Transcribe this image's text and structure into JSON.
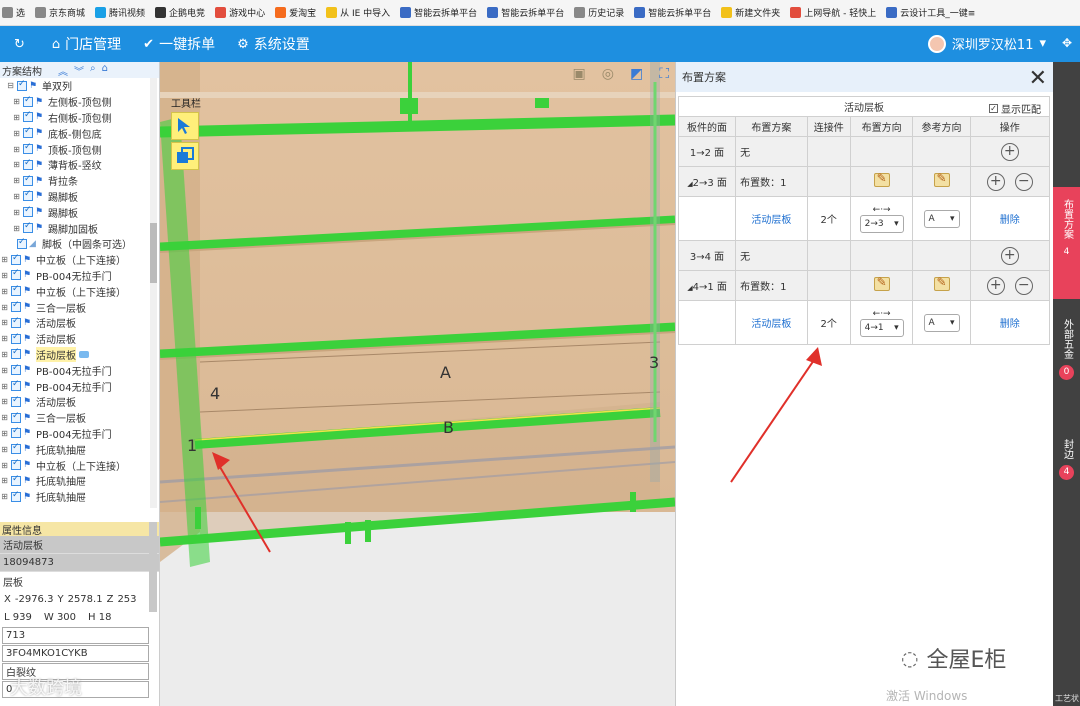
{
  "bookmarks": [
    {
      "label": "选",
      "color": "#888"
    },
    {
      "label": "京东商城",
      "color": "#888"
    },
    {
      "label": "腾讯视频",
      "color": "#19a0e6"
    },
    {
      "label": "企鹅电竞",
      "color": "#333"
    },
    {
      "label": "游戏中心",
      "color": "#e24d3d"
    },
    {
      "label": "爱淘宝",
      "color": "#f56b1d"
    },
    {
      "label": "从 IE 中导入",
      "color": "#f2c11a"
    },
    {
      "label": "智能云拆单平台",
      "color": "#3a6bc4"
    },
    {
      "label": "智能云拆单平台",
      "color": "#3a6bc4"
    },
    {
      "label": "历史记录",
      "color": "#888"
    },
    {
      "label": "智能云拆单平台",
      "color": "#3a6bc4"
    },
    {
      "label": "新建文件夹",
      "color": "#f2c11a"
    },
    {
      "label": "上网导航 - 轻快上",
      "color": "#e24d3d"
    },
    {
      "label": "云设计工具_一键≡",
      "color": "#3a6bc4"
    }
  ],
  "nav": {
    "items": [
      {
        "icon": "refresh-icon",
        "glyph": "↻",
        "label": ""
      },
      {
        "icon": "home-icon",
        "glyph": "⌂",
        "label": "门店管理"
      },
      {
        "icon": "shield-check-icon",
        "glyph": "✔",
        "label": "一键拆单"
      },
      {
        "icon": "gear-icon",
        "glyph": "⚙",
        "label": "系统设置"
      }
    ],
    "user": "深圳罗汉松11",
    "user_caret": "▾",
    "expand_glyph": "✥"
  },
  "tree": {
    "header": "方案结构",
    "nodes": [
      {
        "label": "单双列",
        "exp": "⊟",
        "flag": true,
        "indent": 1
      },
      {
        "label": "左侧板-顶包侧",
        "exp": "⊞",
        "flag": true,
        "indent": 2
      },
      {
        "label": "右侧板-顶包侧",
        "exp": "⊞",
        "flag": true,
        "indent": 2
      },
      {
        "label": "底板-侧包底",
        "exp": "⊞",
        "flag": true,
        "indent": 2
      },
      {
        "label": "顶板-顶包侧",
        "exp": "⊞",
        "flag": true,
        "indent": 2
      },
      {
        "label": "薄背板-竖纹",
        "exp": "⊞",
        "flag": true,
        "indent": 2
      },
      {
        "label": "背拉条",
        "exp": "⊞",
        "flag": true,
        "indent": 2
      },
      {
        "label": "踢脚板",
        "exp": "⊞",
        "flag": true,
        "indent": 2
      },
      {
        "label": "踢脚板",
        "exp": "⊞",
        "flag": true,
        "indent": 2
      },
      {
        "label": "踢脚加固板",
        "exp": "⊞",
        "flag": true,
        "indent": 2
      },
      {
        "label": "脚板（中圆条可选）",
        "exp": "",
        "flag": false,
        "indent": 1
      },
      {
        "label": "中立板（上下连接）",
        "exp": "⊞",
        "flag": true,
        "indent": 0
      },
      {
        "label": "PB-004无拉手门",
        "exp": "⊞",
        "flag": true,
        "indent": 0
      },
      {
        "label": "中立板（上下连接）",
        "exp": "⊞",
        "flag": true,
        "indent": 0
      },
      {
        "label": "三合一层板",
        "exp": "⊞",
        "flag": true,
        "indent": 0
      },
      {
        "label": "活动层板",
        "exp": "⊞",
        "flag": true,
        "indent": 0
      },
      {
        "label": "活动层板",
        "exp": "⊞",
        "flag": true,
        "indent": 0
      },
      {
        "label": "活动层板",
        "exp": "⊞",
        "flag": true,
        "indent": 0,
        "selected": true
      },
      {
        "label": "PB-004无拉手门",
        "exp": "⊞",
        "flag": true,
        "indent": 0
      },
      {
        "label": "PB-004无拉手门",
        "exp": "⊞",
        "flag": true,
        "indent": 0
      },
      {
        "label": "活动层板",
        "exp": "⊞",
        "flag": true,
        "indent": 0
      },
      {
        "label": "三合一层板",
        "exp": "⊞",
        "flag": true,
        "indent": 0
      },
      {
        "label": "PB-004无拉手门",
        "exp": "⊞",
        "flag": true,
        "indent": 0
      },
      {
        "label": "托底轨抽屉",
        "exp": "⊞",
        "flag": true,
        "indent": 0
      },
      {
        "label": "中立板（上下连接）",
        "exp": "⊞",
        "flag": true,
        "indent": 0
      },
      {
        "label": "托底轨抽屉",
        "exp": "⊞",
        "flag": true,
        "indent": 0
      },
      {
        "label": "托底轨抽屉",
        "exp": "⊞",
        "flag": true,
        "indent": 0
      }
    ]
  },
  "props": {
    "title": "属性信息",
    "name": "活动层板",
    "id": "18094873",
    "type": "层板",
    "x_label": "X",
    "x_value": "-2976.3",
    "y_label": "Y",
    "y_value": "2578.1",
    "z_label": "Z",
    "z_value": "253",
    "l_label": "L",
    "l_value": "939",
    "w_label": "W",
    "w_value": "300",
    "h_label": "H",
    "h_value": "18",
    "field1": "713",
    "field2": "3FO4MKO1CYKB",
    "field3": "白裂纹",
    "field4": "0"
  },
  "viewport": {
    "toolbar_label": "工具栏",
    "labels": {
      "a": "A",
      "b": "B",
      "n1": "1",
      "n3": "3",
      "n4": "4"
    }
  },
  "panel": {
    "title": "布置方案",
    "section": "活动层板",
    "show_match": "显示匹配",
    "columns": [
      "板件的面",
      "布置方案",
      "连接件",
      "布置方向",
      "参考方向",
      "操作"
    ],
    "rows": [
      {
        "kind": "face",
        "face": "1→2 面",
        "plan": "无"
      },
      {
        "kind": "group",
        "face": "2→3 面",
        "plan": "布置数：1"
      },
      {
        "kind": "detail",
        "plan": "活动层板",
        "conn": "2个",
        "dir_arrow": "←·→",
        "dir": "2→3",
        "ref": "A",
        "action": "删除"
      },
      {
        "kind": "face",
        "face": "3→4 面",
        "plan": "无"
      },
      {
        "kind": "group",
        "face": "4→1 面",
        "plan": "布置数：1"
      },
      {
        "kind": "detail",
        "plan": "活动层板",
        "conn": "2个",
        "dir_arrow": "←·→",
        "dir": "4→1",
        "ref": "A",
        "action": "删除"
      }
    ]
  },
  "side_tabs": [
    {
      "label": "布置方案",
      "count": "4",
      "active": true
    },
    {
      "label": "外部五金",
      "count": "0",
      "active": false
    },
    {
      "label": "封边",
      "count": "4",
      "active": false
    }
  ],
  "side_footer": "工艺状",
  "watermark": {
    "windows": "激活 Windows",
    "brand": "全屋E柜",
    "left": "大数跨境"
  },
  "colors": {
    "nav_bg": "#1e8fe0",
    "accent_red": "#e8425b",
    "panel_green": "#3bd13b",
    "cabinet_wood": "#e8c7a2"
  }
}
